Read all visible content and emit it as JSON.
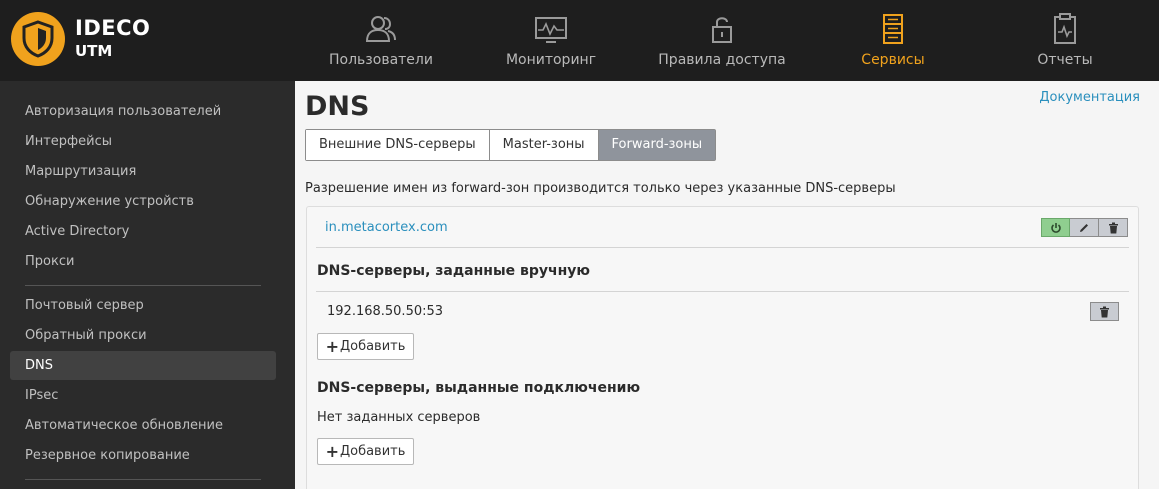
{
  "brand": {
    "line1": "IDECO",
    "line2": "UTM"
  },
  "nav": [
    {
      "label": "Пользователи",
      "icon": "users-icon"
    },
    {
      "label": "Мониторинг",
      "icon": "monitor-icon"
    },
    {
      "label": "Правила доступа",
      "icon": "unlock-icon"
    },
    {
      "label": "Сервисы",
      "icon": "server-icon",
      "active": true
    },
    {
      "label": "Отчеты",
      "icon": "clipboard-icon"
    }
  ],
  "sidebar": {
    "items": [
      {
        "label": "Авторизация пользователей"
      },
      {
        "label": "Интерфейсы"
      },
      {
        "label": "Маршрутизация"
      },
      {
        "label": "Обнаружение устройств"
      },
      {
        "label": "Active Directory"
      },
      {
        "label": "Прокси"
      },
      {
        "label": "Почтовый сервер"
      },
      {
        "label": "Обратный прокси"
      },
      {
        "label": "DNS",
        "active": true
      },
      {
        "label": "IPsec"
      },
      {
        "label": "Автоматическое обновление"
      },
      {
        "label": "Резервное копирование"
      }
    ]
  },
  "main": {
    "title": "DNS",
    "doc_link": "Документация",
    "tabs": [
      {
        "label": "Внешние DNS-серверы"
      },
      {
        "label": "Master-зоны"
      },
      {
        "label": "Forward-зоны",
        "active": true
      }
    ],
    "info": "Разрешение имен из forward-зон производится только через указанные DNS-серверы",
    "zone": {
      "name": "in.metacortex.com",
      "manual_title": "DNS-серверы, заданные вручную",
      "manual_servers": [
        "192.168.50.50:53"
      ],
      "add_label": "Добавить",
      "conn_title": "DNS-серверы, выданные подключению",
      "conn_empty": "Нет заданных серверов"
    }
  },
  "colors": {
    "accent": "#f0a21d",
    "link": "#2a8fbd",
    "active_tab": "#8f949c",
    "power": "#8fce8f"
  }
}
